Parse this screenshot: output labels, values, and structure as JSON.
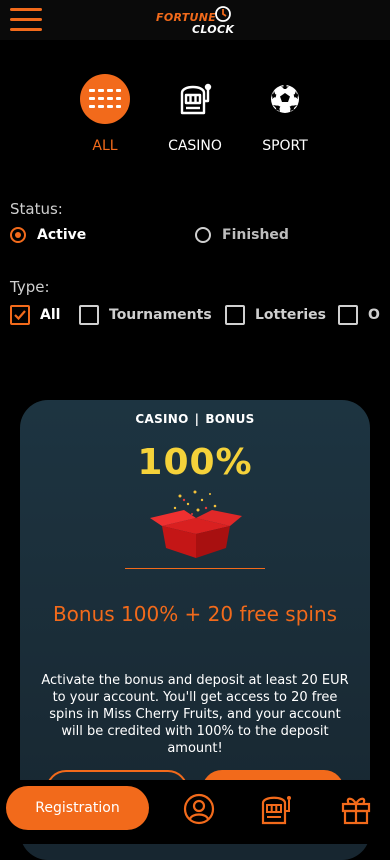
{
  "header": {
    "logo_line1": "FORTUNE",
    "logo_line2": "CLOCK"
  },
  "categories": [
    {
      "label": "ALL",
      "icon": "grid-icon",
      "active": true
    },
    {
      "label": "CASINO",
      "icon": "slot-machine-icon",
      "active": false
    },
    {
      "label": "SPORT",
      "icon": "soccer-ball-icon",
      "active": false
    }
  ],
  "status": {
    "label": "Status:",
    "options": [
      {
        "label": "Active",
        "selected": true
      },
      {
        "label": "Finished",
        "selected": false
      }
    ]
  },
  "type": {
    "label": "Type:",
    "options": [
      {
        "label": "All",
        "checked": true
      },
      {
        "label": "Tournaments",
        "checked": false
      },
      {
        "label": "Lotteries",
        "checked": false
      },
      {
        "label": "O",
        "checked": false
      }
    ]
  },
  "promo": {
    "tag1": "CASINO",
    "tag2": "BONUS",
    "percent": "100%",
    "title": "Bonus 100% + 20 free spins",
    "description": "Activate the bonus and deposit at least 20 EUR to your account. You'll get access to 20 free spins in Miss Cherry Fruits, and your account will be credited with 100% to the deposit amount!"
  },
  "bottom_nav": {
    "registration": "Registration",
    "icons": [
      "user-icon",
      "slot-machine-icon",
      "gift-icon"
    ]
  },
  "colors": {
    "accent": "#f26a1b",
    "card_bg": "#1a2c37",
    "percent": "#f5d23a"
  }
}
